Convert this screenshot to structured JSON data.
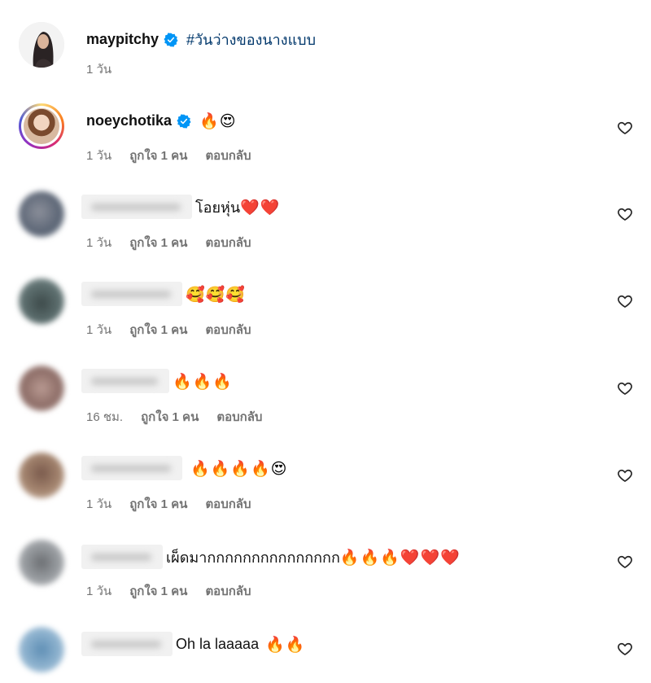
{
  "post": {
    "username": "maypitchy",
    "caption": "#วันว่างของนางแบบ",
    "time": "1 วัน"
  },
  "comments": [
    {
      "username": "noeychotika",
      "verified": true,
      "text": "",
      "emoji": "🔥😍",
      "time": "1 วัน",
      "likes": "ถูกใจ 1 คน",
      "reply": "ตอบกลับ"
    },
    {
      "username": "",
      "text": "โอยหุ่น",
      "emoji": "❤️❤️",
      "time": "1 วัน",
      "likes": "ถูกใจ 1 คน",
      "reply": "ตอบกลับ"
    },
    {
      "username": "",
      "text": "",
      "emoji": "🥰🥰🥰",
      "time": "1 วัน",
      "likes": "ถูกใจ 1 คน",
      "reply": "ตอบกลับ"
    },
    {
      "username": "",
      "text": "",
      "emoji": "🔥🔥🔥",
      "time": "16 ชม.",
      "likes": "ถูกใจ 1 คน",
      "reply": "ตอบกลับ"
    },
    {
      "username": "",
      "text": "",
      "emoji": "🔥🔥🔥🔥😍",
      "time": "1 วัน",
      "likes": "ถูกใจ 1 คน",
      "reply": "ตอบกลับ"
    },
    {
      "username": "",
      "text": "เผ็ดมากกกกกกกกกกกกกกก",
      "emoji": "🔥🔥🔥❤️❤️❤️",
      "time": "1 วัน",
      "likes": "ถูกใจ 1 คน",
      "reply": "ตอบกลับ"
    },
    {
      "username": "",
      "text": "Oh la laaaaa",
      "emoji": "🔥🔥",
      "time": "",
      "likes": "",
      "reply": ""
    }
  ],
  "icons": {
    "like": "heart-outline-icon",
    "verified": "verified-badge-icon"
  },
  "colors": {
    "verified": "#0095f6",
    "caption_link": "#00376b",
    "meta": "#737373"
  }
}
